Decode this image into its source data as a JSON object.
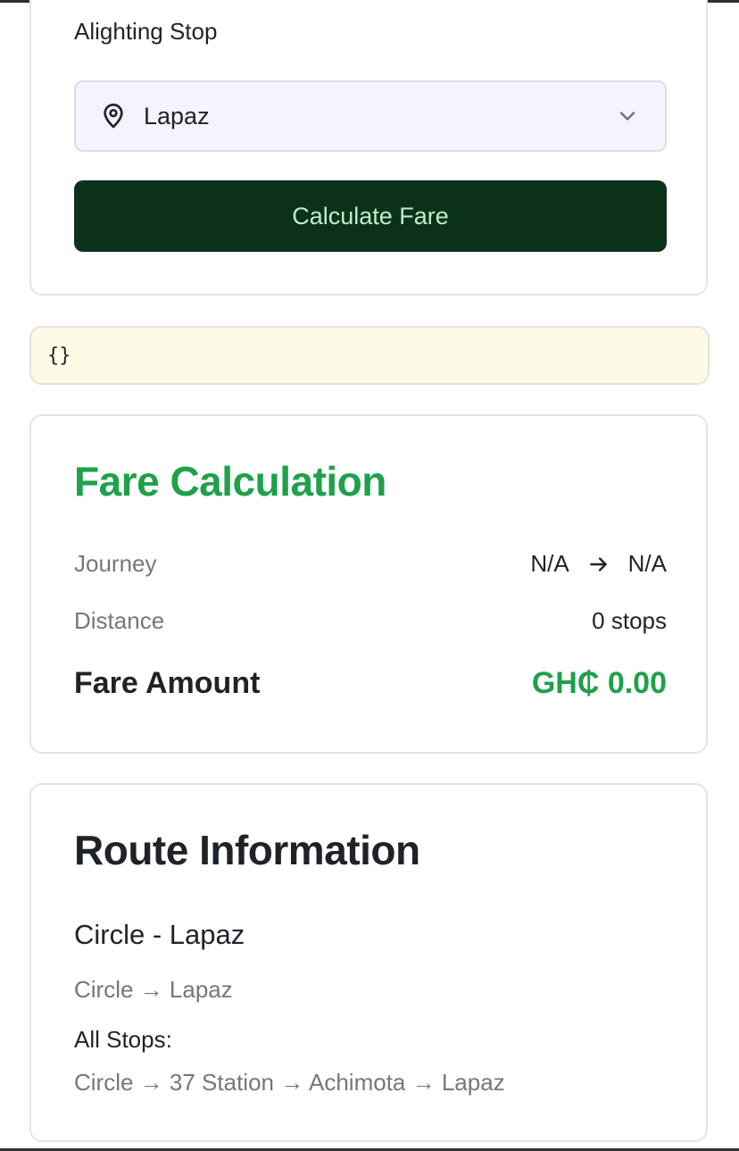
{
  "form": {
    "label": "Alighting Stop",
    "selected_stop": "Lapaz",
    "calculate_label": "Calculate Fare"
  },
  "debug_output": "{}",
  "fare": {
    "title": "Fare Calculation",
    "journey_label": "Journey",
    "journey_from": "N/A",
    "journey_to": "N/A",
    "distance_label": "Distance",
    "distance_value": "0 stops",
    "amount_label": "Fare Amount",
    "amount_value": "GH₵ 0.00"
  },
  "route": {
    "title": "Route Information",
    "name": "Circle - Lapaz",
    "summary": "Circle → Lapaz",
    "all_stops_label": "All Stops:",
    "all_stops": "Circle → 37 Station → Achimota → Lapaz"
  },
  "colors": {
    "accent_green": "#1fa04a",
    "button_bg": "#0b311b",
    "button_text": "#bdeec8",
    "select_bg": "#f4f3fe",
    "debug_bg": "#fdfbe6"
  },
  "icons": [
    "map-pin-icon",
    "chevron-down-icon",
    "arrow-right-icon"
  ]
}
